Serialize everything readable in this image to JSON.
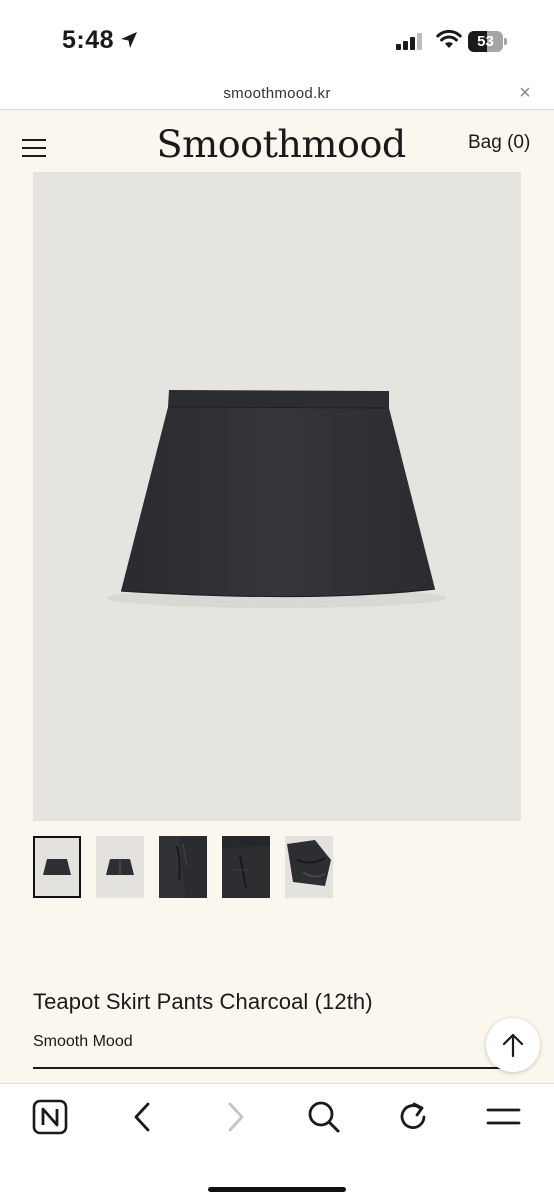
{
  "status_bar": {
    "time": "5:48",
    "battery_text": "53",
    "battery_level": 0.53,
    "icons": [
      "location-arrow-icon",
      "cellular-signal-icon",
      "wifi-icon",
      "battery-icon"
    ]
  },
  "browser": {
    "url": "smoothmood.kr",
    "close_symbol": "×",
    "toolbar_icons": [
      "naver-home-icon",
      "back-icon",
      "forward-icon",
      "search-icon",
      "reload-icon",
      "menu-icon"
    ]
  },
  "header": {
    "logo": "Smoothmood",
    "bag_label": "Bag (0)"
  },
  "product": {
    "title": "Teapot Skirt Pants Charcoal (12th)",
    "brand": "Smooth Mood",
    "thumbnail_count": 5,
    "selected_thumbnail": 1
  },
  "colors": {
    "page_background": "#fbf7ef",
    "image_background": "#e5e4e1",
    "skirt": "#2e2f33"
  }
}
